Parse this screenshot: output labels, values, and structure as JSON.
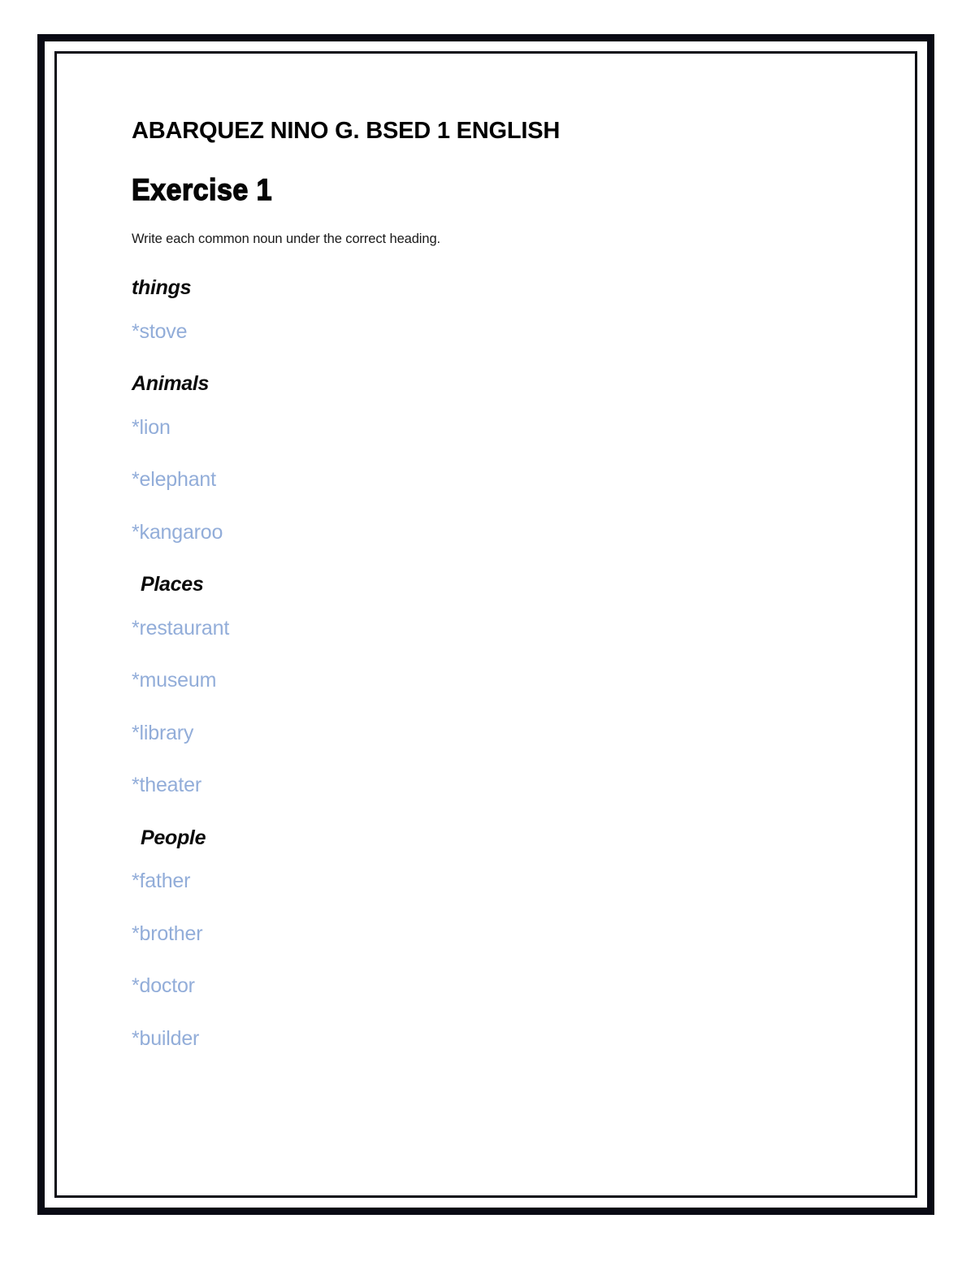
{
  "document": {
    "title": "ABARQUEZ NINO G. BSED 1 ENGLISH",
    "exercise_heading": "Exercise 1",
    "instruction": "Write each common noun under the correct heading.",
    "accent_color": "#92add9",
    "text_color": "#000000",
    "border_color": "#090a14",
    "categories": [
      {
        "heading": "things",
        "indented": false,
        "items": [
          "*stove"
        ]
      },
      {
        "heading": "Animals",
        "indented": false,
        "items": [
          "*lion",
          "*elephant",
          "*kangaroo"
        ]
      },
      {
        "heading": "Places",
        "indented": true,
        "items": [
          "*restaurant",
          "*museum",
          "*library",
          "*theater"
        ]
      },
      {
        "heading": "People",
        "indented": true,
        "items": [
          "*father",
          "*brother",
          "*doctor",
          "*builder"
        ]
      }
    ]
  }
}
